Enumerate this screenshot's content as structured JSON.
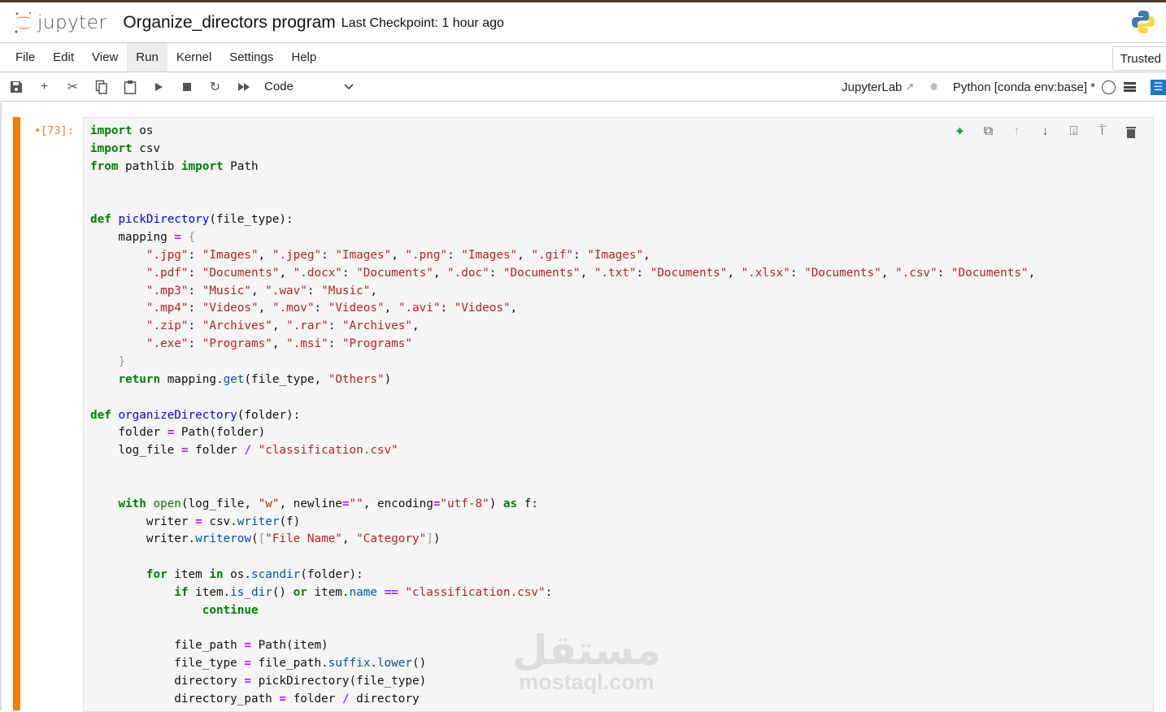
{
  "header": {
    "logo_text": "jupyter",
    "notebook_title": "Organize_directors program",
    "checkpoint": "Last Checkpoint: 1 hour ago"
  },
  "menu": {
    "items": [
      "File",
      "Edit",
      "View",
      "Run",
      "Kernel",
      "Settings",
      "Help"
    ],
    "active": "Run",
    "trusted": "Trusted"
  },
  "toolbar": {
    "cell_type": "Code",
    "jupyterlab_link": "JupyterLab",
    "kernel": "Python [conda env:base] *"
  },
  "cell": {
    "prompt": "•[73]:",
    "lines": [
      "import os",
      "import csv",
      "from pathlib import Path",
      "",
      "",
      "def pickDirectory(file_type):",
      "    mapping = {",
      "        \".jpg\": \"Images\", \".jpeg\": \"Images\", \".png\": \"Images\", \".gif\": \"Images\",",
      "        \".pdf\": \"Documents\", \".docx\": \"Documents\", \".doc\": \"Documents\", \".txt\": \"Documents\", \".xlsx\": \"Documents\", \".csv\": \"Documents\",",
      "        \".mp3\": \"Music\", \".wav\": \"Music\",",
      "        \".mp4\": \"Videos\", \".mov\": \"Videos\", \".avi\": \"Videos\",",
      "        \".zip\": \"Archives\", \".rar\": \"Archives\",",
      "        \".exe\": \"Programs\", \".msi\": \"Programs\"",
      "    }",
      "    return mapping.get(file_type, \"Others\")",
      "",
      "def organizeDirectory(folder):",
      "    folder = Path(folder)",
      "    log_file = folder / \"classification.csv\"",
      "",
      "",
      "    with open(log_file, \"w\", newline=\"\", encoding=\"utf-8\") as f:",
      "        writer = csv.writer(f)",
      "        writer.writerow([\"File Name\", \"Category\"])",
      "",
      "        for item in os.scandir(folder):",
      "            if item.is_dir() or item.name == \"classification.csv\":",
      "                continue",
      "",
      "            file_path = Path(item)",
      "            file_type = file_path.suffix.lower()",
      "            directory = pickDirectory(file_type)",
      "            directory_path = folder / directory"
    ]
  },
  "watermark": {
    "arabic": "مستقل",
    "latin": "mostaql.com"
  },
  "colors": {
    "accent": "#f57c00",
    "keyword": "#008000",
    "string": "#ba2121"
  }
}
